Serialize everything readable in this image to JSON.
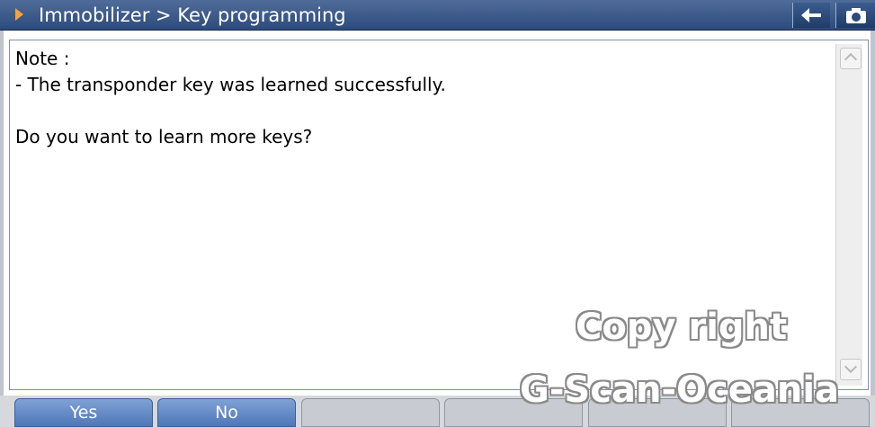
{
  "title_bar": {
    "breadcrumb": "Immobilizer > Key programming",
    "arrow_icon": "play-right-icon",
    "back_icon": "arrow-left-icon",
    "camera_icon": "camera-icon"
  },
  "message": {
    "line1": "Note :",
    "line2": "- The transponder key was learned successfully.",
    "line3": "",
    "line4": "Do you want to learn more keys?"
  },
  "watermark": {
    "line1": "Copy right",
    "line2": "G-Scan-Oceania"
  },
  "function_keys": [
    {
      "label": "Yes",
      "enabled": true
    },
    {
      "label": "No",
      "enabled": true
    },
    {
      "label": "",
      "enabled": false
    },
    {
      "label": "",
      "enabled": false
    },
    {
      "label": "",
      "enabled": false
    },
    {
      "label": "",
      "enabled": false
    }
  ],
  "colors": {
    "titlebar": "#2c4a7c",
    "active_key": "#4f77b7",
    "inactive_key": "#c8cbd1",
    "arrow_accent": "#f2a33a"
  }
}
